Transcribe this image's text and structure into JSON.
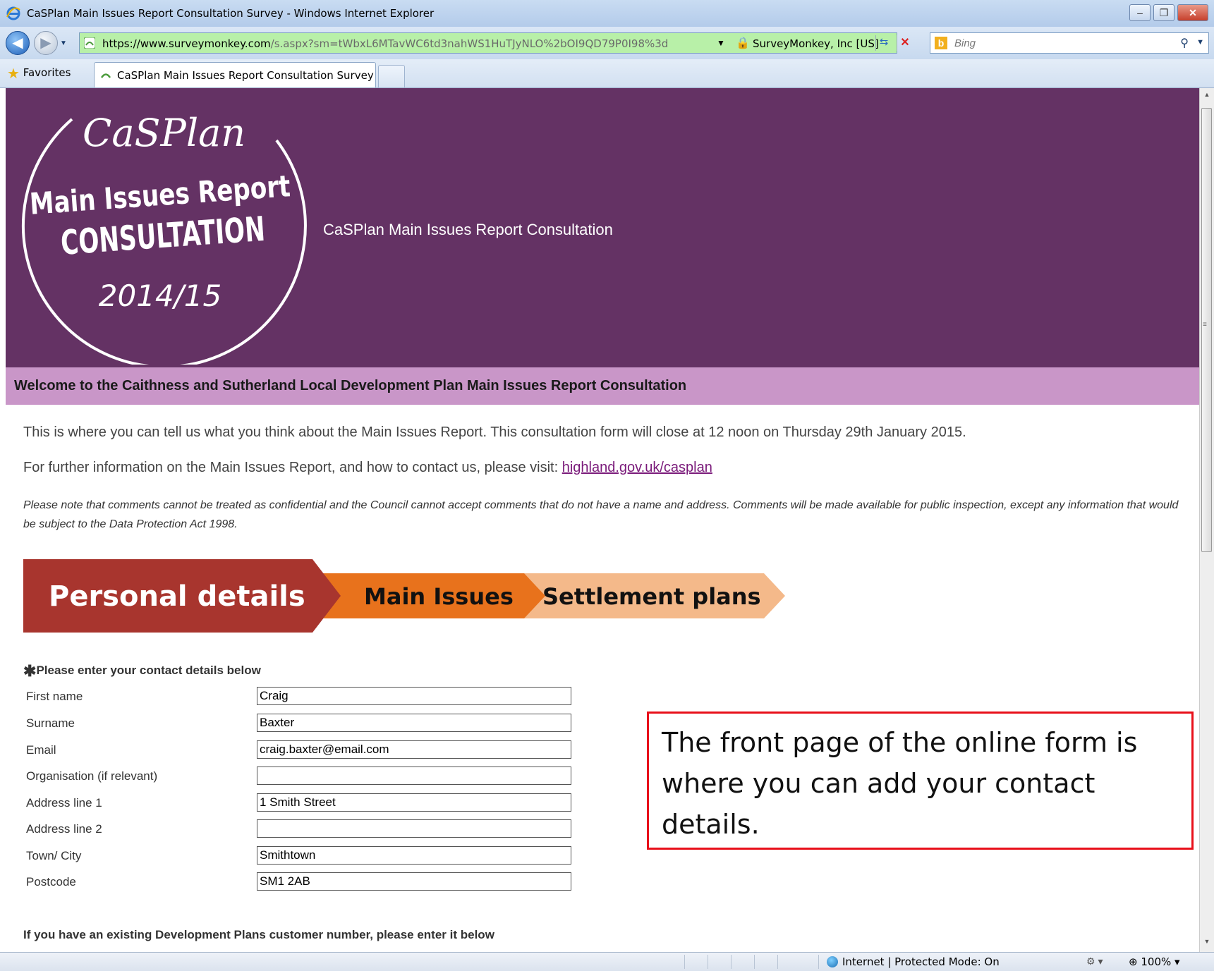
{
  "window": {
    "title": "CaSPlan Main Issues Report Consultation Survey - Windows Internet Explorer",
    "minimize": "–",
    "restore": "❐",
    "close": "✕"
  },
  "addressbar": {
    "url_prefix": "https://",
    "url_host": "www.surveymonkey.com",
    "url_rest": "/s.aspx?sm=tWbxL6MTavWC6td3nahWS1HuTJyNLO%2bOI9QD79P0I98%3d",
    "certificate": "SurveyMonkey, Inc [US]",
    "search_placeholder": "Bing"
  },
  "favorites_bar": {
    "favorites_label": "Favorites",
    "tab_title": "CaSPlan Main Issues Report Consultation Survey"
  },
  "banner": {
    "logo_script": "CaSPlan",
    "logo_line1": "Main Issues Report",
    "logo_line2": "CONSULTATION",
    "logo_year": "2014/15",
    "title": "CaSPlan Main Issues Report Consultation"
  },
  "welcome": "Welcome to the Caithness and Sutherland Local Development Plan Main Issues Report Consultation",
  "intro": "This is where you can tell us what you think about the Main Issues Report. This consultation form will close at 12 noon on Thursday 29th January 2015.",
  "further": {
    "text": "For further information on the Main Issues Report, and how to contact us, please visit: ",
    "link": "highland.gov.uk/casplan"
  },
  "note": "Please note that comments cannot be treated as confidential and the Council cannot accept comments that do not have a name and address. Comments will be made available for public inspection, except any information that would be subject to the Data Protection Act 1998.",
  "steps": [
    {
      "label": "Personal details",
      "color": "#a8352e",
      "text_color": "#ffffff"
    },
    {
      "label": "Main Issues",
      "color": "#e8721c",
      "text_color": "#111111"
    },
    {
      "label": "Settlement plans",
      "color": "#f4b98a",
      "text_color": "#111111"
    }
  ],
  "form": {
    "required_mark": "✱",
    "title": "Please enter your contact details below",
    "fields": [
      {
        "label": "First name",
        "value": "Craig"
      },
      {
        "label": "Surname",
        "value": "Baxter"
      },
      {
        "label": "Email",
        "value": "craig.baxter@email.com"
      },
      {
        "label": "Organisation (if relevant)",
        "value": ""
      },
      {
        "label": "Address line 1",
        "value": "1 Smith Street"
      },
      {
        "label": "Address line 2",
        "value": ""
      },
      {
        "label": "Town/ City",
        "value": "Smithtown"
      },
      {
        "label": "Postcode",
        "value": "SM1 2AB"
      }
    ],
    "customer_number_prompt": "If you have an existing Development Plans customer number, please enter it below"
  },
  "callout": "The front page of the online form is where you can add your contact details.",
  "statusbar": {
    "zone": "Internet | Protected Mode: On",
    "zoom": "100%"
  },
  "colors": {
    "banner": "#643264",
    "welcome_bar": "#c996c8",
    "callout_border": "#e8101a"
  }
}
